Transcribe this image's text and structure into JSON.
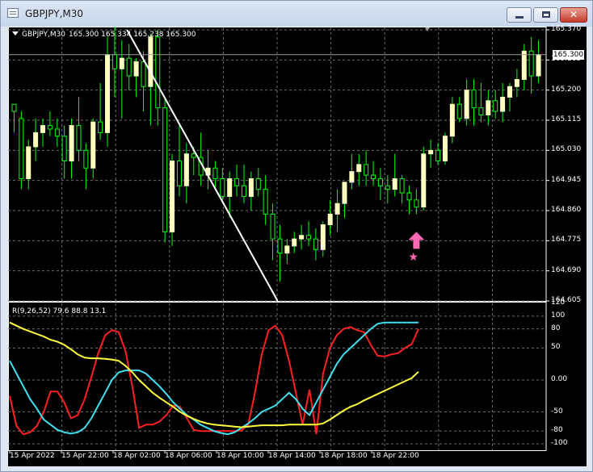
{
  "window": {
    "title": "GBPJPY,M30",
    "buttons": {
      "minimize": "minimize-icon",
      "maximize": "maximize-icon",
      "close": "✕"
    }
  },
  "chart": {
    "symbol": "GBPJPY,M30",
    "ohlc": "165.300 165.334 165.238 165.300",
    "current_price": "165.300",
    "price_axis": [
      "165.370",
      "165.285",
      "165.200",
      "165.115",
      "165.030",
      "164.945",
      "164.860",
      "164.775",
      "164.690",
      "164.605"
    ],
    "time_axis": [
      "15 Apr 2022",
      "15 Apr 22:00",
      "18 Apr 02:00",
      "18 Apr 06:00",
      "18 Apr 10:00",
      "18 Apr 14:00",
      "18 Apr 18:00",
      "18 Apr 22:00"
    ],
    "colors": {
      "bull": "#ffffc0",
      "bear": "#00ff00",
      "trendline": "#ffffff",
      "arrow": "#ff69b4"
    },
    "signals": {
      "arrow": "arrow-up-icon",
      "star": "★"
    }
  },
  "indicator": {
    "header": "R(9,26,52) 79.6 88.8 13.1",
    "axis": [
      "120",
      "100",
      "80",
      "50",
      "0.00",
      "-50",
      "-80",
      "-100"
    ],
    "series_colors": {
      "fast": "#ff2020",
      "mid": "#40e0f0",
      "slow": "#ffff40"
    }
  },
  "chart_data": [
    {
      "type": "candlestick",
      "title": "GBPJPY,M30",
      "ylim": [
        164.605,
        165.37
      ],
      "x_ticks": [
        "15 Apr 2022",
        "15 Apr 22:00",
        "18 Apr 02:00",
        "18 Apr 06:00",
        "18 Apr 10:00",
        "18 Apr 14:00",
        "18 Apr 18:00",
        "18 Apr 22:00"
      ],
      "candles": [
        [
          165.16,
          165.16,
          165.08,
          165.14
        ],
        [
          165.12,
          165.14,
          164.92,
          164.95
        ],
        [
          164.95,
          165.06,
          164.92,
          165.04
        ],
        [
          165.04,
          165.12,
          165.0,
          165.08
        ],
        [
          165.08,
          165.12,
          165.04,
          165.1
        ],
        [
          165.1,
          165.14,
          165.07,
          165.09
        ],
        [
          165.09,
          165.12,
          165.04,
          165.07
        ],
        [
          165.07,
          165.1,
          164.95,
          165.0
        ],
        [
          165.0,
          165.12,
          164.95,
          165.1
        ],
        [
          165.1,
          165.18,
          165.0,
          165.03
        ],
        [
          165.03,
          165.05,
          164.92,
          164.98
        ],
        [
          164.98,
          165.12,
          164.95,
          165.11
        ],
        [
          165.11,
          165.22,
          165.06,
          165.08
        ],
        [
          165.08,
          165.35,
          165.04,
          165.3
        ],
        [
          165.3,
          165.4,
          165.18,
          165.26
        ],
        [
          165.26,
          165.34,
          165.12,
          165.29
        ],
        [
          165.29,
          165.33,
          165.2,
          165.24
        ],
        [
          165.24,
          165.29,
          165.18,
          165.28
        ],
        [
          165.28,
          165.31,
          165.14,
          165.21
        ],
        [
          165.21,
          165.36,
          165.1,
          165.35
        ],
        [
          165.35,
          165.37,
          165.1,
          165.15
        ],
        [
          165.15,
          165.18,
          164.77,
          164.8
        ],
        [
          164.8,
          165.02,
          164.76,
          165.0
        ],
        [
          165.0,
          165.1,
          164.9,
          164.93
        ],
        [
          164.93,
          165.05,
          164.88,
          165.02
        ],
        [
          165.02,
          165.04,
          164.96,
          165.01
        ],
        [
          165.01,
          165.08,
          164.93,
          164.96
        ],
        [
          164.96,
          165.03,
          164.92,
          164.98
        ],
        [
          164.98,
          165.0,
          164.92,
          164.95
        ],
        [
          164.95,
          164.98,
          164.88,
          164.9
        ],
        [
          164.9,
          164.97,
          164.84,
          164.95
        ],
        [
          164.95,
          164.99,
          164.9,
          164.93
        ],
        [
          164.93,
          164.99,
          164.88,
          164.9
        ],
        [
          164.9,
          164.97,
          164.86,
          164.95
        ],
        [
          164.95,
          164.98,
          164.9,
          164.92
        ],
        [
          164.92,
          164.96,
          164.82,
          164.85
        ],
        [
          164.85,
          164.88,
          164.72,
          164.78
        ],
        [
          164.78,
          164.82,
          164.66,
          164.74
        ],
        [
          164.74,
          164.78,
          164.71,
          164.76
        ],
        [
          164.76,
          164.8,
          164.74,
          164.78
        ],
        [
          164.78,
          164.82,
          164.75,
          164.79
        ],
        [
          164.79,
          164.83,
          164.76,
          164.78
        ],
        [
          164.78,
          164.81,
          164.72,
          164.75
        ],
        [
          164.75,
          164.83,
          164.73,
          164.82
        ],
        [
          164.82,
          164.89,
          164.79,
          164.85
        ],
        [
          164.85,
          164.92,
          164.8,
          164.88
        ],
        [
          164.88,
          164.94,
          164.84,
          164.94
        ],
        [
          164.94,
          165.02,
          164.92,
          164.97
        ],
        [
          164.97,
          165.02,
          164.93,
          164.99
        ],
        [
          164.99,
          165.03,
          164.93,
          164.96
        ],
        [
          164.96,
          165.0,
          164.93,
          164.95
        ],
        [
          164.95,
          164.98,
          164.89,
          164.93
        ],
        [
          164.93,
          164.96,
          164.88,
          164.92
        ],
        [
          164.92,
          165.02,
          164.9,
          164.95
        ],
        [
          164.95,
          164.96,
          164.88,
          164.91
        ],
        [
          164.91,
          164.93,
          164.85,
          164.89
        ],
        [
          164.89,
          164.92,
          164.85,
          164.87
        ],
        [
          164.87,
          165.04,
          164.86,
          165.02
        ],
        [
          165.02,
          165.06,
          164.98,
          165.03
        ],
        [
          165.03,
          165.05,
          164.99,
          165.0
        ],
        [
          165.0,
          165.08,
          164.99,
          165.07
        ],
        [
          165.07,
          165.18,
          165.05,
          165.16
        ],
        [
          165.16,
          165.18,
          165.11,
          165.12
        ],
        [
          165.12,
          165.23,
          165.1,
          165.2
        ],
        [
          165.2,
          165.23,
          165.1,
          165.15
        ],
        [
          165.15,
          165.22,
          165.11,
          165.13
        ],
        [
          165.13,
          165.2,
          165.1,
          165.17
        ],
        [
          165.17,
          165.2,
          165.12,
          165.14
        ],
        [
          165.14,
          165.22,
          165.11,
          165.18
        ],
        [
          165.18,
          165.22,
          165.14,
          165.21
        ],
        [
          165.21,
          165.26,
          165.18,
          165.23
        ],
        [
          165.23,
          165.33,
          165.2,
          165.31
        ],
        [
          165.31,
          165.35,
          165.19,
          165.24
        ],
        [
          165.24,
          165.34,
          165.22,
          165.3
        ]
      ],
      "trendline": [
        [
          0.221,
          165.37
        ],
        [
          0.501,
          164.605
        ]
      ],
      "current_price": 165.3
    },
    {
      "type": "line",
      "title": "R(9,26,52)",
      "ylim": [
        -110,
        120
      ],
      "series": [
        {
          "name": "9",
          "color": "#ff2020",
          "values": [
            -25,
            -72,
            -85,
            -82,
            -72,
            -50,
            -18,
            -18,
            -35,
            -60,
            -55,
            -30,
            5,
            42,
            70,
            78,
            75,
            45,
            -10,
            -75,
            -70,
            -70,
            -65,
            -55,
            -40,
            -42,
            -60,
            -78,
            -80,
            -80,
            -80,
            -80,
            -80,
            -80,
            -79,
            -70,
            -20,
            40,
            78,
            85,
            70,
            30,
            -20,
            -70,
            -15,
            -85,
            10,
            50,
            70,
            80,
            83,
            78,
            75,
            55,
            38,
            37,
            40,
            42,
            50,
            56,
            80
          ]
        },
        {
          "name": "26",
          "color": "#40e0f0",
          "values": [
            30,
            10,
            -10,
            -30,
            -45,
            -62,
            -70,
            -78,
            -82,
            -84,
            -82,
            -75,
            -60,
            -40,
            -20,
            0,
            12,
            15,
            15,
            15,
            10,
            0,
            -10,
            -22,
            -35,
            -45,
            -55,
            -62,
            -70,
            -75,
            -80,
            -83,
            -85,
            -82,
            -75,
            -68,
            -60,
            -50,
            -45,
            -40,
            -30,
            -20,
            -30,
            -45,
            -55,
            -35,
            -15,
            5,
            25,
            40,
            50,
            60,
            70,
            80,
            88,
            90,
            90,
            90,
            90,
            90,
            90
          ]
        },
        {
          "name": "52",
          "color": "#ffff40",
          "values": [
            90,
            85,
            80,
            76,
            72,
            68,
            63,
            60,
            55,
            48,
            40,
            35,
            34,
            34,
            33,
            32,
            30,
            22,
            12,
            0,
            -10,
            -20,
            -28,
            -35,
            -42,
            -50,
            -56,
            -61,
            -65,
            -68,
            -70,
            -71,
            -72,
            -73,
            -74,
            -73,
            -72,
            -71,
            -71,
            -71,
            -71,
            -70,
            -70,
            -70,
            -70,
            -70,
            -68,
            -62,
            -55,
            -48,
            -42,
            -38,
            -32,
            -27,
            -22,
            -17,
            -12,
            -7,
            -2,
            3,
            13
          ]
        }
      ]
    }
  ]
}
